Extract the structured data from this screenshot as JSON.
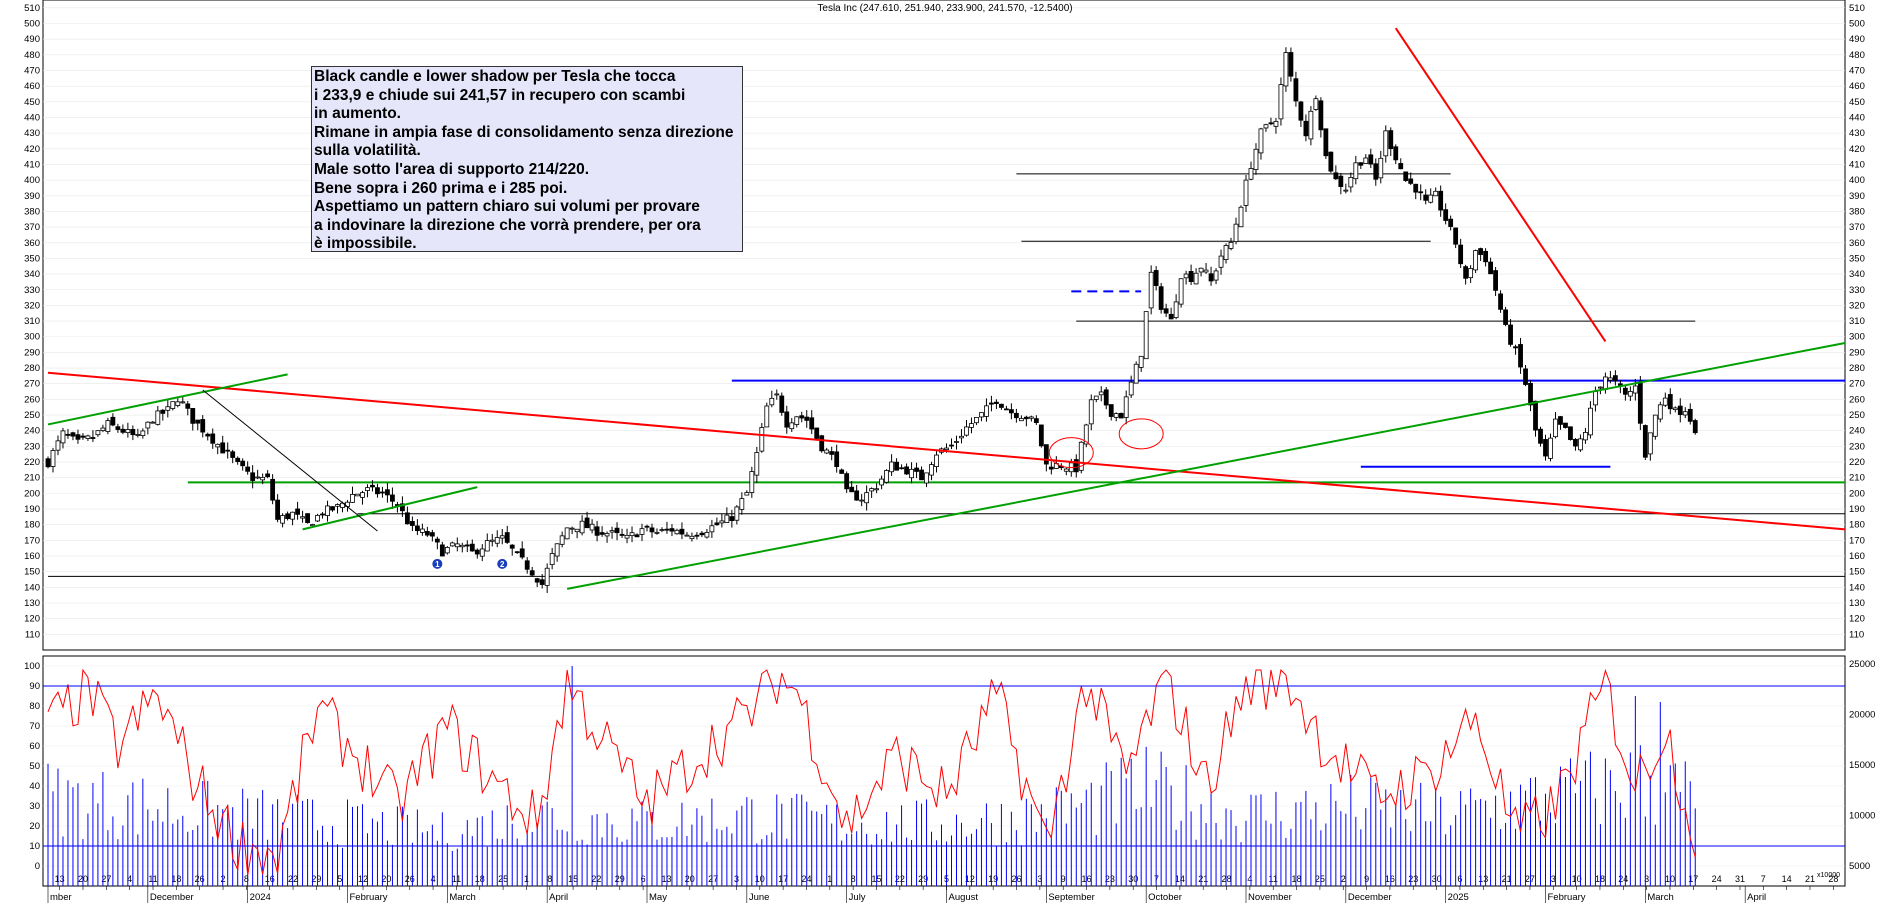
{
  "chart_data": [
    {
      "type": "candlestick",
      "title": "Tesla Inc (247.610, 251.940, 233.900, 241.570, -12.5400)",
      "ylim": [
        100,
        515
      ],
      "yticks": [
        110,
        120,
        130,
        140,
        150,
        160,
        170,
        180,
        190,
        200,
        210,
        220,
        230,
        240,
        250,
        260,
        270,
        280,
        290,
        300,
        310,
        320,
        330,
        340,
        350,
        360,
        370,
        380,
        390,
        400,
        410,
        420,
        430,
        440,
        450,
        460,
        470,
        480,
        490,
        500,
        510
      ],
      "x_day_labels": [
        "13",
        "20",
        "27",
        "4",
        "11",
        "18",
        "26",
        "2",
        "8",
        "16",
        "22",
        "29",
        "5",
        "12",
        "20",
        "26",
        "4",
        "11",
        "18",
        "25",
        "1",
        "8",
        "15",
        "22",
        "29",
        "6",
        "13",
        "20",
        "27",
        "3",
        "10",
        "17",
        "24",
        "1",
        "8",
        "15",
        "22",
        "29",
        "5",
        "12",
        "19",
        "26",
        "3",
        "9",
        "16",
        "23",
        "30",
        "7",
        "14",
        "21",
        "28",
        "4",
        "11",
        "18",
        "25",
        "2",
        "9",
        "16",
        "23",
        "30",
        "6",
        "13",
        "21",
        "27",
        "3",
        "10",
        "18",
        "24",
        "3",
        "10",
        "17",
        "24",
        "31",
        "7",
        "14",
        "21",
        "28"
      ],
      "x_month_labels": [
        "mber",
        "December",
        "2024",
        "February",
        "March",
        "April",
        "May",
        "June",
        "July",
        "August",
        "September",
        "October",
        "November",
        "December",
        "2025",
        "February",
        "March",
        "April"
      ],
      "close_series": [
        {
          "t": 0,
          "v": 220
        },
        {
          "t": 3,
          "v": 238
        },
        {
          "t": 6,
          "v": 232
        },
        {
          "t": 9,
          "v": 236
        },
        {
          "t": 12,
          "v": 244
        },
        {
          "t": 15,
          "v": 240
        },
        {
          "t": 18,
          "v": 235
        },
        {
          "t": 21,
          "v": 248
        },
        {
          "t": 24,
          "v": 253
        },
        {
          "t": 26,
          "v": 261
        },
        {
          "t": 27,
          "v": 257
        },
        {
          "t": 29,
          "v": 247
        },
        {
          "t": 32,
          "v": 238
        },
        {
          "t": 35,
          "v": 228
        },
        {
          "t": 38,
          "v": 218
        },
        {
          "t": 41,
          "v": 210
        },
        {
          "t": 44,
          "v": 209
        },
        {
          "t": 46,
          "v": 183
        },
        {
          "t": 49,
          "v": 187
        },
        {
          "t": 52,
          "v": 180
        },
        {
          "t": 55,
          "v": 188
        },
        {
          "t": 58,
          "v": 191
        },
        {
          "t": 61,
          "v": 199
        },
        {
          "t": 64,
          "v": 202
        },
        {
          "t": 67,
          "v": 200
        },
        {
          "t": 70,
          "v": 193
        },
        {
          "t": 73,
          "v": 177
        },
        {
          "t": 76,
          "v": 174
        },
        {
          "t": 79,
          "v": 163
        },
        {
          "t": 82,
          "v": 167
        },
        {
          "t": 85,
          "v": 162
        },
        {
          "t": 88,
          "v": 168
        },
        {
          "t": 91,
          "v": 171
        },
        {
          "t": 94,
          "v": 160
        },
        {
          "t": 97,
          "v": 150
        },
        {
          "t": 99,
          "v": 142
        },
        {
          "t": 101,
          "v": 160
        },
        {
          "t": 104,
          "v": 178
        },
        {
          "t": 107,
          "v": 180
        },
        {
          "t": 110,
          "v": 176
        },
        {
          "t": 113,
          "v": 174
        },
        {
          "t": 116,
          "v": 171
        },
        {
          "t": 119,
          "v": 177
        },
        {
          "t": 122,
          "v": 175
        },
        {
          "t": 125,
          "v": 177
        },
        {
          "t": 128,
          "v": 174
        },
        {
          "t": 131,
          "v": 176
        },
        {
          "t": 134,
          "v": 180
        },
        {
          "t": 137,
          "v": 185
        },
        {
          "t": 140,
          "v": 200
        },
        {
          "t": 142,
          "v": 225
        },
        {
          "t": 144,
          "v": 255
        },
        {
          "t": 146,
          "v": 262
        },
        {
          "t": 148,
          "v": 245
        },
        {
          "t": 150,
          "v": 250
        },
        {
          "t": 152,
          "v": 247
        },
        {
          "t": 155,
          "v": 230
        },
        {
          "t": 158,
          "v": 220
        },
        {
          "t": 160,
          "v": 200
        },
        {
          "t": 163,
          "v": 197
        },
        {
          "t": 166,
          "v": 205
        },
        {
          "t": 169,
          "v": 218
        },
        {
          "t": 172,
          "v": 215
        },
        {
          "t": 175,
          "v": 210
        },
        {
          "t": 178,
          "v": 226
        },
        {
          "t": 181,
          "v": 230
        },
        {
          "t": 184,
          "v": 242
        },
        {
          "t": 187,
          "v": 250
        },
        {
          "t": 190,
          "v": 260
        },
        {
          "t": 193,
          "v": 252
        },
        {
          "t": 196,
          "v": 249
        },
        {
          "t": 198,
          "v": 244
        },
        {
          "t": 200,
          "v": 218
        },
        {
          "t": 203,
          "v": 218
        },
        {
          "t": 206,
          "v": 216
        },
        {
          "t": 209,
          "v": 258
        },
        {
          "t": 211,
          "v": 262
        },
        {
          "t": 213,
          "v": 252
        },
        {
          "t": 215,
          "v": 250
        },
        {
          "t": 217,
          "v": 270
        },
        {
          "t": 219,
          "v": 290
        },
        {
          "t": 221,
          "v": 340
        },
        {
          "t": 223,
          "v": 320
        },
        {
          "t": 225,
          "v": 310
        },
        {
          "t": 227,
          "v": 340
        },
        {
          "t": 229,
          "v": 338
        },
        {
          "t": 231,
          "v": 345
        },
        {
          "t": 233,
          "v": 335
        },
        {
          "t": 235,
          "v": 352
        },
        {
          "t": 237,
          "v": 360
        },
        {
          "t": 239,
          "v": 385
        },
        {
          "t": 241,
          "v": 410
        },
        {
          "t": 243,
          "v": 430
        },
        {
          "t": 246,
          "v": 440
        },
        {
          "t": 248,
          "v": 480
        },
        {
          "t": 250,
          "v": 450
        },
        {
          "t": 252,
          "v": 430
        },
        {
          "t": 254,
          "v": 455
        },
        {
          "t": 256,
          "v": 415
        },
        {
          "t": 258,
          "v": 400
        },
        {
          "t": 260,
          "v": 395
        },
        {
          "t": 262,
          "v": 410
        },
        {
          "t": 264,
          "v": 415
        },
        {
          "t": 266,
          "v": 400
        },
        {
          "t": 268,
          "v": 430
        },
        {
          "t": 270,
          "v": 415
        },
        {
          "t": 272,
          "v": 400
        },
        {
          "t": 274,
          "v": 395
        },
        {
          "t": 276,
          "v": 385
        },
        {
          "t": 278,
          "v": 390
        },
        {
          "t": 280,
          "v": 375
        },
        {
          "t": 282,
          "v": 360
        },
        {
          "t": 284,
          "v": 335
        },
        {
          "t": 286,
          "v": 355
        },
        {
          "t": 288,
          "v": 350
        },
        {
          "t": 290,
          "v": 330
        },
        {
          "t": 292,
          "v": 305
        },
        {
          "t": 294,
          "v": 290
        },
        {
          "t": 296,
          "v": 270
        },
        {
          "t": 298,
          "v": 240
        },
        {
          "t": 300,
          "v": 222
        },
        {
          "t": 302,
          "v": 245
        },
        {
          "t": 304,
          "v": 240
        },
        {
          "t": 306,
          "v": 228
        },
        {
          "t": 308,
          "v": 240
        },
        {
          "t": 310,
          "v": 265
        },
        {
          "t": 312,
          "v": 275
        },
        {
          "t": 314,
          "v": 270
        },
        {
          "t": 316,
          "v": 262
        },
        {
          "t": 318,
          "v": 268
        },
        {
          "t": 320,
          "v": 225
        },
        {
          "t": 322,
          "v": 250
        },
        {
          "t": 324,
          "v": 262
        },
        {
          "t": 326,
          "v": 252
        },
        {
          "t": 328,
          "v": 254
        },
        {
          "t": 330,
          "v": 241.57
        }
      ],
      "trendlines": [
        {
          "color": "#ff0000",
          "points": [
            [
              0,
              277
            ],
            [
              360,
              177
            ]
          ]
        },
        {
          "color": "#ff0000",
          "points": [
            [
              270,
              497
            ],
            [
              312,
              297
            ]
          ]
        },
        {
          "color": "#00a000",
          "points": [
            [
              104,
              139
            ],
            [
              360,
              296
            ]
          ]
        },
        {
          "color": "#00a000",
          "points": [
            [
              0,
              244
            ],
            [
              48,
              276
            ]
          ]
        },
        {
          "color": "#00a000",
          "points": [
            [
              51,
              177
            ],
            [
              86,
              204
            ]
          ]
        },
        {
          "color": "#000000",
          "points": [
            [
              31,
              266
            ],
            [
              66,
              176
            ]
          ]
        }
      ],
      "horizontal_levels": [
        {
          "value": 207,
          "color": "#00a000"
        },
        {
          "value": 272,
          "color": "#0000ff"
        },
        {
          "value": 217,
          "color": "#0000ff"
        },
        {
          "value": 187,
          "color": "#000000"
        },
        {
          "value": 147,
          "color": "#000000"
        },
        {
          "value": 404,
          "color": "#000000"
        },
        {
          "value": 361,
          "color": "#000000"
        },
        {
          "value": 310,
          "color": "#000000"
        },
        {
          "value": 329,
          "color": "#0000ff",
          "dashed": true
        }
      ],
      "markers": [
        {
          "label": "1",
          "value": 155
        },
        {
          "label": "2",
          "value": 155
        }
      ],
      "ellipses": [
        {
          "value": 238
        },
        {
          "value": 226
        }
      ],
      "annotation": [
        "Black candle e lower shadow per Tesla che tocca",
        "i 233,9 e chiude sui 241,57 in recupero con scambi",
        "in aumento.",
        "Rimane in ampia fase di consolidamento senza direzione",
        "sulla volatilità.",
        "Male sotto l'area di supporto 214/220.",
        "Bene sopra i 260 prima e i 285 poi.",
        "Aspettiamo un pattern chiaro sui volumi per provare",
        "a indovinare la direzione che vorrà prendere, per ora",
        "è impossibile."
      ]
    },
    {
      "type": "oscillator_volume",
      "left_ylim": [
        -10,
        105
      ],
      "left_yticks": [
        0,
        10,
        20,
        30,
        40,
        50,
        60,
        70,
        80,
        90,
        100
      ],
      "right_yticks": [
        5000,
        10000,
        15000,
        20000,
        25000
      ],
      "right_axis_note": "x10000",
      "oscillator_levels": [
        90,
        10
      ],
      "oscillator_color": "#ff0000",
      "volume_color": "#0000ff",
      "oscillator_keypoints": [
        {
          "t": 0,
          "v": 70
        },
        {
          "t": 8,
          "v": 88
        },
        {
          "t": 14,
          "v": 60
        },
        {
          "t": 22,
          "v": 85
        },
        {
          "t": 30,
          "v": 40
        },
        {
          "t": 38,
          "v": 12
        },
        {
          "t": 46,
          "v": 5
        },
        {
          "t": 54,
          "v": 78
        },
        {
          "t": 62,
          "v": 55
        },
        {
          "t": 70,
          "v": 30
        },
        {
          "t": 80,
          "v": 70
        },
        {
          "t": 90,
          "v": 40
        },
        {
          "t": 98,
          "v": 22
        },
        {
          "t": 104,
          "v": 92
        },
        {
          "t": 112,
          "v": 60
        },
        {
          "t": 120,
          "v": 30
        },
        {
          "t": 130,
          "v": 55
        },
        {
          "t": 140,
          "v": 75
        },
        {
          "t": 146,
          "v": 95
        },
        {
          "t": 150,
          "v": 88
        },
        {
          "t": 160,
          "v": 20
        },
        {
          "t": 170,
          "v": 55
        },
        {
          "t": 180,
          "v": 35
        },
        {
          "t": 190,
          "v": 85
        },
        {
          "t": 200,
          "v": 10
        },
        {
          "t": 208,
          "v": 92
        },
        {
          "t": 216,
          "v": 45
        },
        {
          "t": 224,
          "v": 95
        },
        {
          "t": 232,
          "v": 40
        },
        {
          "t": 240,
          "v": 90
        },
        {
          "t": 248,
          "v": 95
        },
        {
          "t": 256,
          "v": 60
        },
        {
          "t": 266,
          "v": 35
        },
        {
          "t": 276,
          "v": 45
        },
        {
          "t": 286,
          "v": 75
        },
        {
          "t": 294,
          "v": 15
        },
        {
          "t": 302,
          "v": 30
        },
        {
          "t": 312,
          "v": 90
        },
        {
          "t": 318,
          "v": 40
        },
        {
          "t": 324,
          "v": 70
        },
        {
          "t": 330,
          "v": 15
        }
      ],
      "volume_keypoints": [
        {
          "t": 0,
          "v": 40
        },
        {
          "t": 20,
          "v": 35
        },
        {
          "t": 40,
          "v": 30
        },
        {
          "t": 60,
          "v": 25
        },
        {
          "t": 80,
          "v": 20
        },
        {
          "t": 100,
          "v": 30
        },
        {
          "t": 120,
          "v": 25
        },
        {
          "t": 140,
          "v": 30
        },
        {
          "t": 160,
          "v": 25
        },
        {
          "t": 180,
          "v": 25
        },
        {
          "t": 200,
          "v": 30
        },
        {
          "t": 220,
          "v": 45
        },
        {
          "t": 240,
          "v": 30
        },
        {
          "t": 260,
          "v": 35
        },
        {
          "t": 280,
          "v": 30
        },
        {
          "t": 300,
          "v": 40
        },
        {
          "t": 320,
          "v": 50
        },
        {
          "t": 330,
          "v": 40
        }
      ],
      "volume_spikes": [
        {
          "t": 105,
          "v": 100
        },
        {
          "t": 128,
          "v": 15
        },
        {
          "t": 318,
          "v": 85
        },
        {
          "t": 323,
          "v": 82
        }
      ]
    }
  ]
}
